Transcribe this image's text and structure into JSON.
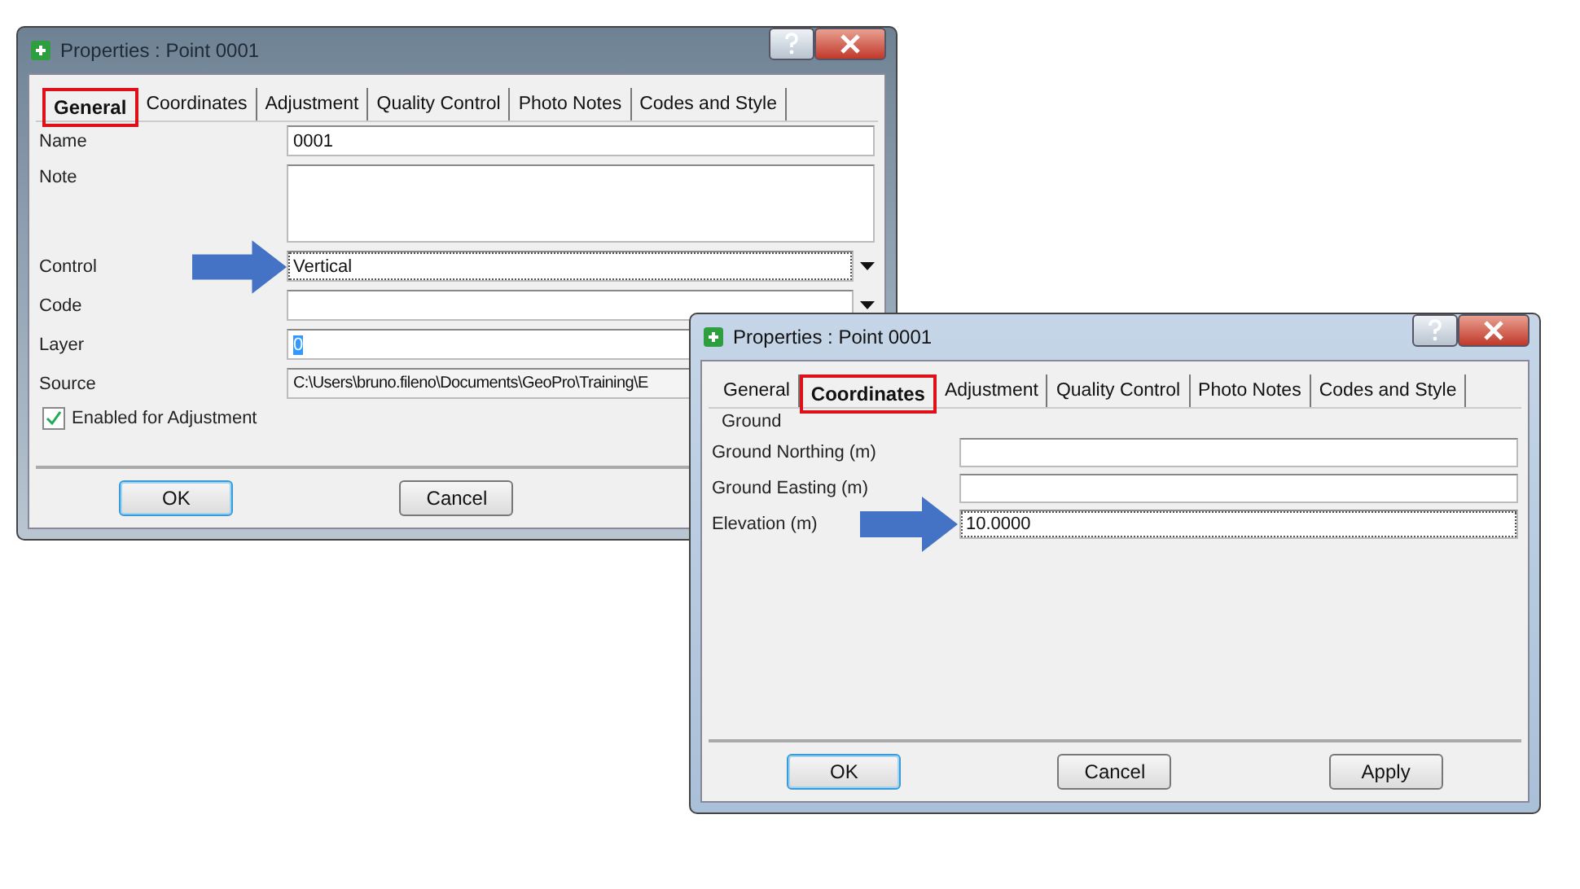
{
  "windows": [
    {
      "title": "Properties : Point 0001",
      "active": false,
      "tabs": [
        {
          "label": "General",
          "selected": true
        },
        {
          "label": "Coordinates",
          "selected": false
        },
        {
          "label": "Adjustment",
          "selected": false
        },
        {
          "label": "Quality Control",
          "selected": false
        },
        {
          "label": "Photo Notes",
          "selected": false
        },
        {
          "label": "Codes and Style",
          "selected": false
        }
      ],
      "fields": [
        {
          "kind": "text",
          "label": "Name",
          "value": "0001"
        },
        {
          "kind": "textarea",
          "label": "Note"
        },
        {
          "kind": "dropdown",
          "label": "Control",
          "value": "Vertical",
          "focused": true,
          "pointed": true
        },
        {
          "kind": "dropdown",
          "label": "Code"
        },
        {
          "kind": "text",
          "label": "Layer",
          "value": "0",
          "focused": true
        },
        {
          "kind": "readonly",
          "label": "Source",
          "value": "C:\\Users\\bruno.fileno\\Documents\\GeoPro\\Training\\E"
        },
        {
          "kind": "checkbox",
          "label": "Enabled for Adjustment",
          "checked": true
        }
      ],
      "buttons": [
        {
          "label": "OK",
          "default": true
        },
        {
          "label": "Cancel",
          "default": false
        }
      ]
    },
    {
      "title": "Properties : Point 0001",
      "active": true,
      "tabs": [
        {
          "label": "General",
          "selected": false
        },
        {
          "label": "Coordinates",
          "selected": true
        },
        {
          "label": "Adjustment",
          "selected": false
        },
        {
          "label": "Quality Control",
          "selected": false
        },
        {
          "label": "Photo Notes",
          "selected": false
        },
        {
          "label": "Codes and Style",
          "selected": false
        }
      ],
      "group": "Ground",
      "fields": [
        {
          "kind": "text",
          "label": "Ground Northing (m)"
        },
        {
          "kind": "text",
          "label": "Ground Easting (m)"
        },
        {
          "kind": "text",
          "label": "Elevation (m)",
          "value": "10.0000",
          "focused": true,
          "pointed": true
        }
      ],
      "buttons": [
        {
          "label": "OK",
          "default": true
        },
        {
          "label": "Cancel",
          "default": false
        },
        {
          "label": "Apply",
          "default": false
        }
      ]
    }
  ]
}
